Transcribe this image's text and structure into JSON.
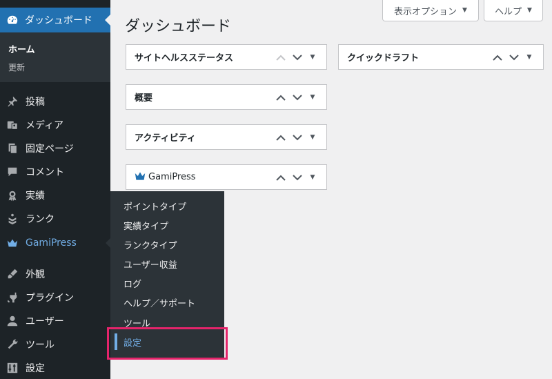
{
  "sidebar": {
    "dashboard": {
      "label": "ダッシュボード",
      "icon": "dashboard-gauge-icon"
    },
    "dashboard_sub": {
      "home": "ホーム",
      "update": "更新"
    },
    "items": [
      {
        "label": "投稿",
        "icon": "pin-icon"
      },
      {
        "label": "メディア",
        "icon": "media-icon"
      },
      {
        "label": "固定ページ",
        "icon": "pages-icon"
      },
      {
        "label": "コメント",
        "icon": "comment-icon"
      },
      {
        "label": "実績",
        "icon": "award-icon"
      },
      {
        "label": "ランク",
        "icon": "rank-icon"
      },
      {
        "label": "GamiPress",
        "icon": "gamipress-crown-icon"
      },
      {
        "label": "外観",
        "icon": "appearance-icon"
      },
      {
        "label": "プラグイン",
        "icon": "plugin-icon"
      },
      {
        "label": "ユーザー",
        "icon": "user-icon"
      },
      {
        "label": "ツール",
        "icon": "tools-icon"
      },
      {
        "label": "設定",
        "icon": "settings-icon"
      }
    ]
  },
  "flyout": {
    "items": [
      "ポイントタイプ",
      "実績タイプ",
      "ランクタイプ",
      "ユーザー収益",
      "ログ",
      "ヘルプ／サポート",
      "ツール",
      "設定"
    ],
    "active": "設定"
  },
  "header": {
    "title": "ダッシュボード",
    "screen_options": "表示オプション",
    "help": "ヘルプ"
  },
  "widgets": {
    "site_health": "サイトヘルスステータス",
    "quick_draft": "クイックドラフト",
    "overview": "概要",
    "activity": "アクティビティ",
    "gamipress": "GamiPress"
  },
  "colors": {
    "sidebar_bg": "#1d2327",
    "submenu_bg": "#2c3338",
    "accent": "#2271b1",
    "active_link": "#72aee6",
    "highlight": "#e5246b"
  }
}
